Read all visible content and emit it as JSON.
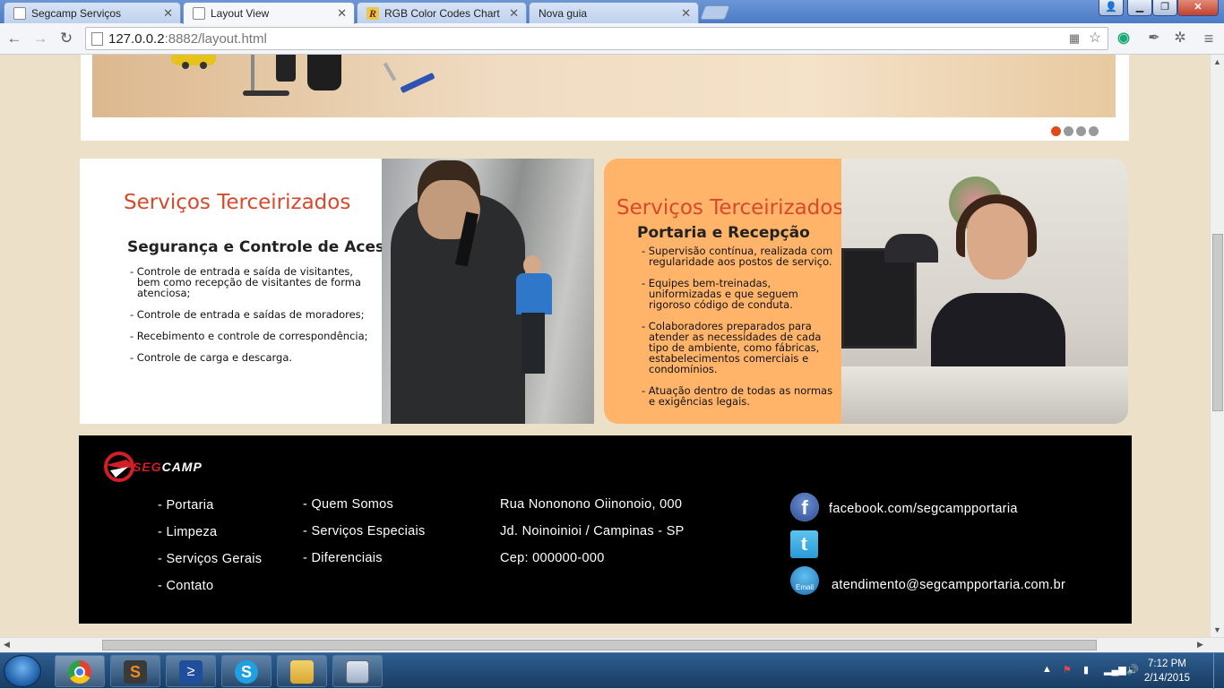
{
  "browser": {
    "tabs": [
      {
        "label": "Segcamp Serviços",
        "active": false
      },
      {
        "label": "Layout View",
        "active": true
      },
      {
        "label": "RGB Color Codes Chart",
        "active": false
      },
      {
        "label": "Nova guia",
        "active": false
      }
    ],
    "url_host": "127.0.0.2",
    "url_rest": ":8882/layout.html"
  },
  "slider": {
    "dots": 4,
    "active_dot": 1
  },
  "services": [
    {
      "title": "Serviços Terceirizados",
      "subtitle": "Segurança e Controle de Acesso",
      "items": [
        "- Controle de entrada e saída de visitantes, bem como recepção de visitantes de forma atenciosa;",
        "- Controle de entrada e saídas de moradores;",
        "- Recebimento e controle de correspondência;",
        "- Controle de carga e descarga."
      ]
    },
    {
      "title": "Serviços Terceirizados",
      "subtitle": "Portaria e Recepção",
      "items": [
        "- Supervisão contínua, realizada com regularidade aos postos de serviço.",
        "- Equipes bem-treinadas, uniformizadas e que seguem rigoroso código de conduta.",
        "- Colaboradores preparados para atender as necessidades de cada tipo de ambiente, como fábricas, estabelecimentos comerciais e condomínios.",
        "- Atuação dentro de todas as normas e exigências legais."
      ]
    }
  ],
  "footer": {
    "logo_text": "SEGCAMP",
    "col1": [
      "- Portaria",
      "- Limpeza",
      "- Serviços Gerais",
      "- Contato"
    ],
    "col2": [
      "- Quem Somos",
      "- Serviços Especiais",
      "- Diferenciais"
    ],
    "address": [
      "Rua Nononono Oiinonoio, 000",
      "Jd. Noinoinioi / Campinas - SP",
      "Cep: 000000-000"
    ],
    "facebook": "facebook.com/segcampportaria",
    "email": "atendimento@segcampportaria.com.br",
    "email_icon_label": "Email"
  },
  "taskbar": {
    "time": "7:12 PM",
    "date": "2/14/2015"
  },
  "colors": {
    "accent": "#d9482b",
    "card2_bg": "#ffb46a",
    "page_bg": "#ede0c8",
    "footer_bg": "#000000"
  }
}
